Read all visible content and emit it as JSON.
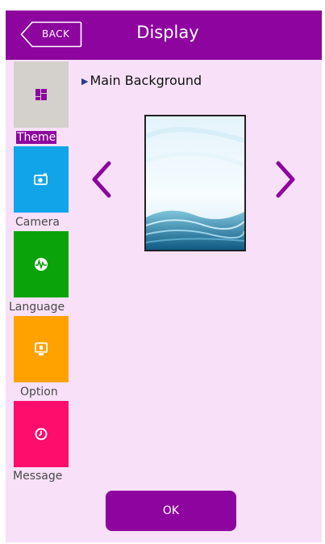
{
  "header": {
    "back_label": "BACK",
    "title": "Display"
  },
  "sidebar": {
    "items": [
      {
        "label": "Theme",
        "icon": "theme-icon",
        "color": "#d4d0cc",
        "active": true
      },
      {
        "label": "Camera",
        "icon": "camera-icon",
        "color": "#11a4e8",
        "active": false
      },
      {
        "label": "Language",
        "icon": "language-icon",
        "color": "#0aa40a",
        "active": false
      },
      {
        "label": "Option",
        "icon": "option-icon",
        "color": "#ffa200",
        "active": false
      },
      {
        "label": "Message",
        "icon": "message-icon",
        "color": "#fe0d6c",
        "active": false
      }
    ]
  },
  "main": {
    "section_title": "Main Background"
  },
  "footer": {
    "ok_label": "OK"
  },
  "colors": {
    "accent": "#8d049e",
    "background": "#f7e0f8"
  }
}
